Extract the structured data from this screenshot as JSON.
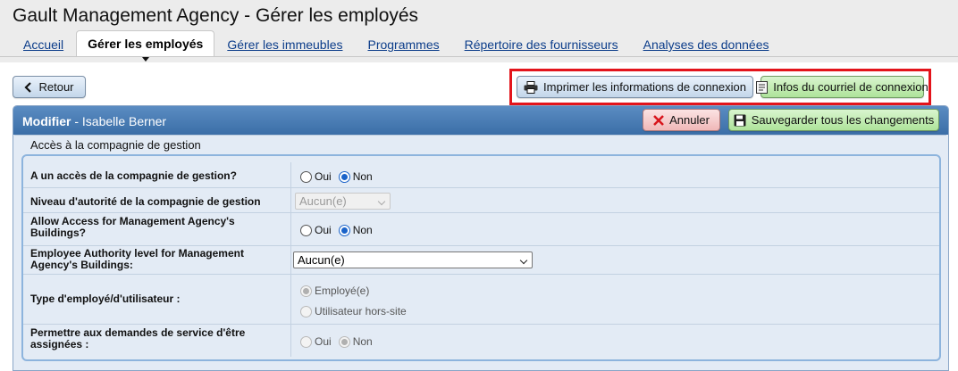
{
  "app": {
    "title": "Gault Management Agency - Gérer les employés"
  },
  "tabs": [
    {
      "label": "Accueil"
    },
    {
      "label": "Gérer les employés"
    },
    {
      "label": "Gérer les immeubles"
    },
    {
      "label": "Programmes"
    },
    {
      "label": "Répertoire des fournisseurs"
    },
    {
      "label": "Analyses des données"
    }
  ],
  "toolbar": {
    "back_label": "Retour",
    "print_label": "Imprimer les informations de connexion",
    "email_label": "Infos du courriel de connexion"
  },
  "panel": {
    "mode": "Modifier",
    "employee": "- Isabelle Berner",
    "cancel_label": "Annuler",
    "save_label": "Sauvegarder tous les changements",
    "section_title": "Accès à la compagnie de gestion"
  },
  "form": {
    "rows": [
      {
        "label": "A un accès de la compagnie de gestion?",
        "options": [
          "Oui",
          "Non"
        ],
        "selected": "Non"
      },
      {
        "label": "Niveau d'autorité de la compagnie de gestion",
        "select_value": "Aucun(e)"
      },
      {
        "label": "Allow Access for Management Agency's Buildings?",
        "options": [
          "Oui",
          "Non"
        ],
        "selected": "Non"
      },
      {
        "label": "Employee Authority level for Management Agency's Buildings:",
        "select_value": "Aucun(e)"
      },
      {
        "label": "Type d'employé/d'utilisateur :",
        "options": [
          "Employé(e)",
          "Utilisateur hors-site"
        ],
        "selected": "Employé(e)"
      },
      {
        "label": "Permettre aux demandes de service d'être assignées :",
        "options": [
          "Oui",
          "Non"
        ],
        "selected": "Non"
      }
    ]
  },
  "colors": {
    "header_blue": "#3b6ea7",
    "highlight_red": "#e3141b",
    "tab_link": "#0c3d8a"
  },
  "icons": {
    "back": "chevron-left-icon",
    "print": "printer-icon",
    "email": "document-icon",
    "cancel": "x-icon",
    "save": "floppy-disk-icon"
  }
}
